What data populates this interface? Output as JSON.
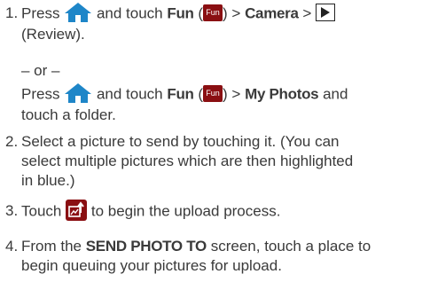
{
  "steps": [
    {
      "number": "1.",
      "part1_press": "Press",
      "part1_mid": "and touch",
      "fun_label": "Fun",
      "paren_open": "(",
      "fun_icon_text": "Fun",
      "paren_close_gt": ") >",
      "camera_label": "Camera",
      "gt": ">",
      "review": "(Review).",
      "or": "– or –",
      "alt_press": "Press",
      "alt_mid": "and touch",
      "alt_fun": "Fun",
      "alt_paren_open": "(",
      "alt_fun_icon_text": "Fun",
      "alt_paren_close_gt": ") >",
      "my_photos": "My Photos",
      "alt_and": "and",
      "alt_end": "touch a folder."
    },
    {
      "number": "2.",
      "line1": "Select a picture to send by touching it. (You can",
      "line2": "select multiple pictures which are then highlighted",
      "line3": "in blue.)"
    },
    {
      "number": "3.",
      "before": "Touch",
      "after": "to begin the upload process."
    },
    {
      "number": "4.",
      "before": "From the",
      "screen_name": "SEND PHOTO TO",
      "after": "screen, touch a place to",
      "line2": "begin queuing your pictures for upload."
    }
  ],
  "icons": {
    "home": "home-icon",
    "fun": "fun-icon",
    "play": "play-icon",
    "upload": "upload-icon"
  },
  "colors": {
    "home_blue": "#1e86c8",
    "fun_red": "#8a0f12",
    "text": "#3a3a3a"
  }
}
